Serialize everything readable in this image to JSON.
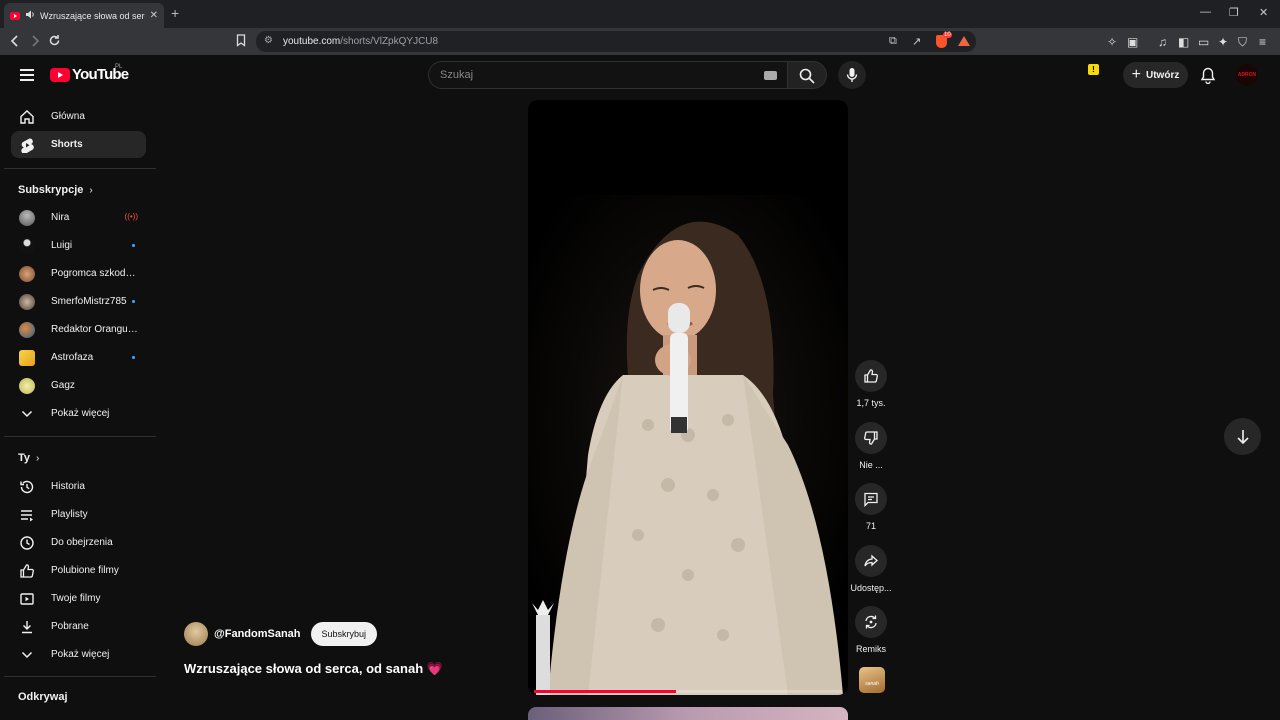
{
  "browser": {
    "tab_title": "Wzruszające słowa od serca, o",
    "tab_close": "✕",
    "new_tab": "+",
    "url_host": "youtube.com",
    "url_path": "/shorts/VlZpkQYJCU8",
    "window_controls": [
      "—",
      "❐",
      "✕"
    ],
    "brave_badge": "10"
  },
  "header": {
    "logo_text": "YouTube",
    "country_code": "PL",
    "search_placeholder": "Szukaj",
    "create_label": "Utwórz",
    "create_plus": "+",
    "avatar_text": "ADRON"
  },
  "sidebar": {
    "main_items": [
      {
        "label": "Główna",
        "icon": "home-icon"
      },
      {
        "label": "Shorts",
        "icon": "shorts-icon",
        "active": true
      }
    ],
    "subs_heading": "Subskrypcje",
    "subscriptions": [
      {
        "label": "Nira",
        "indicator": "live",
        "live_glyph": "((•))"
      },
      {
        "label": "Luigi",
        "indicator": "dot"
      },
      {
        "label": "Pogromca szkodników",
        "indicator": ""
      },
      {
        "label": "SmerfoMistrz785",
        "indicator": "dot"
      },
      {
        "label": "Redaktor Orangutan",
        "indicator": ""
      },
      {
        "label": "Astrofaza",
        "indicator": "dot"
      },
      {
        "label": "Gagz",
        "indicator": ""
      }
    ],
    "subs_more": "Pokaż więcej",
    "you_heading": "Ty",
    "you_items": [
      {
        "label": "Historia",
        "icon": "history-icon"
      },
      {
        "label": "Playlisty",
        "icon": "playlists-icon"
      },
      {
        "label": "Do obejrzenia",
        "icon": "watch-later-icon"
      },
      {
        "label": "Polubione filmy",
        "icon": "liked-icon"
      },
      {
        "label": "Twoje filmy",
        "icon": "your-videos-icon"
      },
      {
        "label": "Pobrane",
        "icon": "downloads-icon"
      }
    ],
    "you_more": "Pokaż więcej",
    "explore_heading": "Odkrywaj"
  },
  "short": {
    "channel_handle": "@FandomSanah",
    "subscribe_label": "Subskrybuj",
    "title": "Wzruszające słowa od serca, od sanah",
    "title_emoji": "💗",
    "progress_fraction": 0.46,
    "actions": {
      "like": "1,7 tys.",
      "dislike": "Nie ...",
      "comments": "71",
      "share": "Udostęp...",
      "remix": "Remiks"
    },
    "sound_thumb_text": "sanah"
  },
  "colors": {
    "background": "#0f0f0f",
    "accent_red": "#ff0033",
    "chip_bg": "#272727",
    "notification_dot": "#3ea6ff"
  }
}
